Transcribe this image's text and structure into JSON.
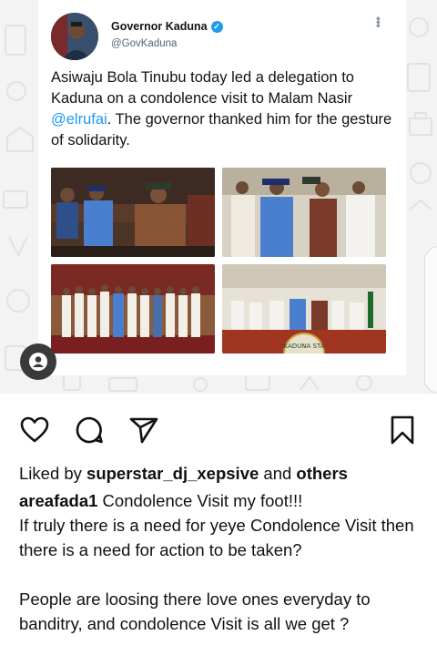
{
  "tweet": {
    "display_name": "Governor Kaduna",
    "handle": "@GovKaduna",
    "text_before_mention": "Asiwaju Bola Tinubu today led a delegation to Kaduna on a condolence visit to Malam Nasir ",
    "mention": "@elrufai",
    "text_after_mention": ". The governor thanked him for the gesture of solidarity.",
    "photo_banner_text": "KADUNA STA"
  },
  "post": {
    "liked_prefix": "Liked by ",
    "liked_user": "superstar_dj_xepsive",
    "liked_mid": " and ",
    "liked_others": "others",
    "comment_user": "areafada1",
    "comment_lines": [
      " Condolence Visit my foot!!!",
      "If truly there is a need for yeye Condolence Visit then there is a need for action to be taken?",
      "People are loosing there love ones everyday to banditry, and condolence Visit is all we get ?"
    ]
  },
  "icons": {
    "like": "heart-icon",
    "comment": "comment-bubble-icon",
    "share": "send-paper-plane-icon",
    "save": "bookmark-icon",
    "profile": "profile-icon",
    "verified": "verified-badge-icon",
    "more": "more-vertical-icon"
  },
  "colors": {
    "twitter_blue": "#1d9bf0",
    "text": "#111111",
    "muted": "#536471"
  }
}
